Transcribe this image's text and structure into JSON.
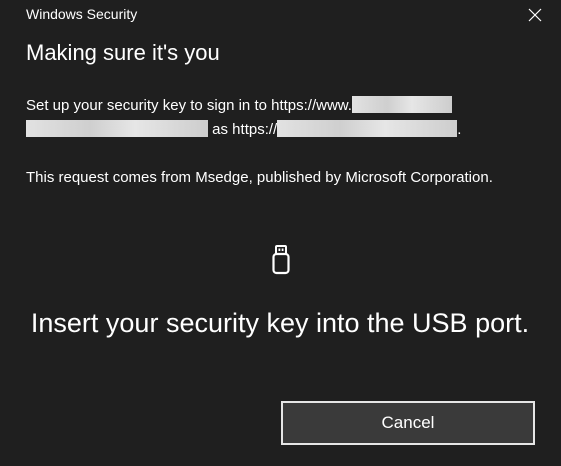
{
  "window": {
    "title": "Windows Security",
    "close_icon": "close-icon"
  },
  "main": {
    "heading": "Making sure it's you",
    "setup_text_prefix": "Set up your security key to sign in to https://www.",
    "setup_text_as": "as https://",
    "setup_text_suffix": ".",
    "request_text": "This request comes from Msedge, published by Microsoft Corporation.",
    "device_icon": "usb-key-icon",
    "instruction": "Insert your security key into the USB port."
  },
  "actions": {
    "cancel_label": "Cancel"
  },
  "colors": {
    "background": "#1f1f1f",
    "text": "#ffffff",
    "button_border": "#e6e6e6",
    "button_fill": "#3a3a3a"
  }
}
